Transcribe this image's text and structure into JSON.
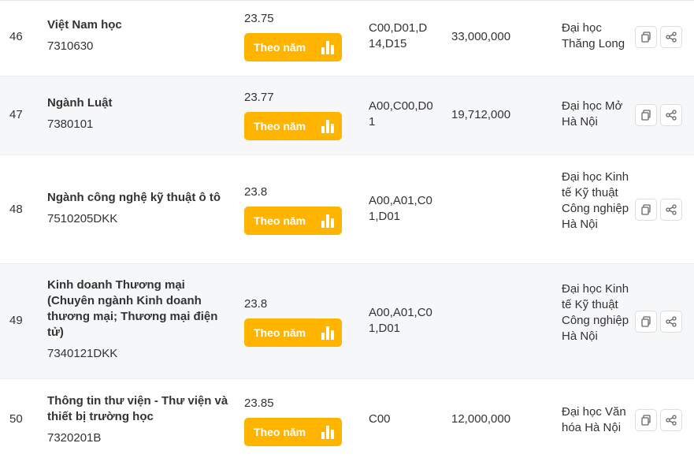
{
  "rows": [
    {
      "stt": "46",
      "major": "Việt Nam học",
      "code": "7310630",
      "score": "23.75",
      "button": "Theo năm",
      "combo": "C00,D01,D14,D15",
      "fee": "33,000,000",
      "school": "Đại học Thăng Long"
    },
    {
      "stt": "47",
      "major": "Ngành Luật",
      "code": "7380101",
      "score": "23.77",
      "button": "Theo năm",
      "combo": "A00,C00,D01",
      "fee": "19,712,000",
      "school": "Đại học Mở Hà Nội"
    },
    {
      "stt": "48",
      "major": "Ngành công nghệ kỹ thuật ô tô",
      "code": "7510205DKK",
      "score": "23.8",
      "button": "Theo năm",
      "combo": "A00,A01,C01,D01",
      "fee": "",
      "school": "Đại học Kinh tế Kỹ thuật Công nghiệp Hà Nội"
    },
    {
      "stt": "49",
      "major": "Kinh doanh Thương mại (Chuyên ngành Kinh doanh thương mại; Thương mại điện tử)",
      "code": "7340121DKK",
      "score": "23.8",
      "button": "Theo năm",
      "combo": "A00,A01,C01,D01",
      "fee": "",
      "school": "Đại học Kinh tế Kỹ thuật Công nghiệp Hà Nội"
    },
    {
      "stt": "50",
      "major": "Thông tin thư viện - Thư viện và thiết bị trường học",
      "code": "7320201B",
      "score": "23.85",
      "button": "Theo năm",
      "combo": "C00",
      "fee": "12,000,000",
      "school": "Đại học Văn hóa Hà Nội"
    }
  ],
  "icons": {
    "year_button": "bar-chart-icon",
    "copy": "copy-icon",
    "share": "share-icon"
  },
  "colors": {
    "accent": "#ffb400",
    "row_alt": "#f6f7f9",
    "text": "#333333"
  }
}
